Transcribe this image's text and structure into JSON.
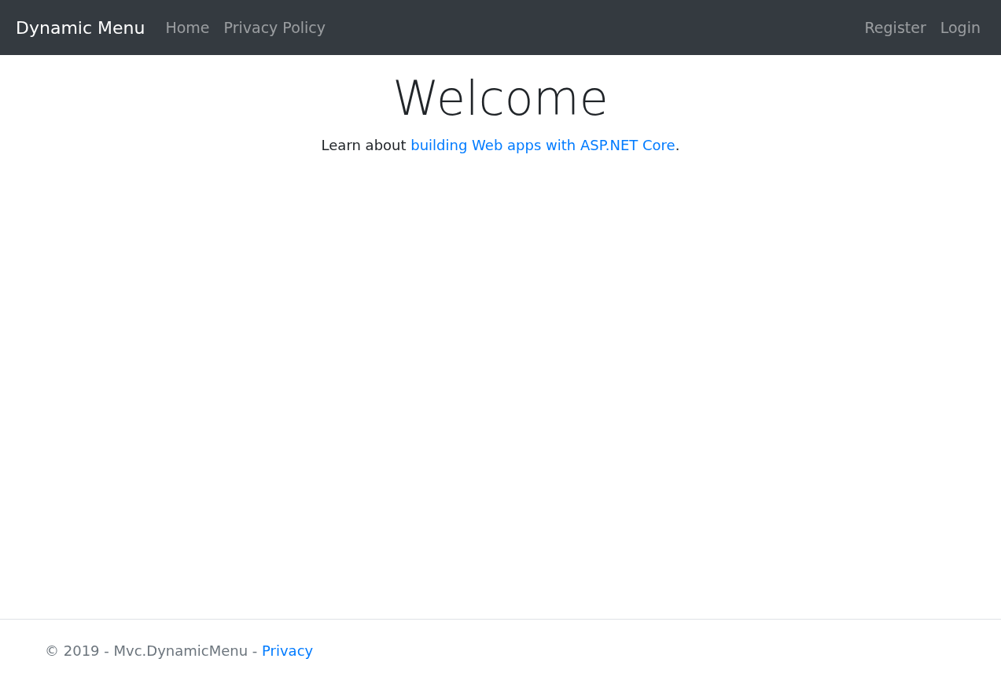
{
  "navbar": {
    "brand": "Dynamic Menu",
    "links": [
      "Home",
      "Privacy Policy"
    ],
    "account_links": [
      "Register",
      "Login"
    ]
  },
  "main": {
    "heading": "Welcome",
    "intro": {
      "before": "Learn about ",
      "link": "building Web apps with ASP.NET Core",
      "after": "."
    }
  },
  "footer": {
    "text": "© 2019 - Mvc.DynamicMenu - ",
    "link": "Privacy"
  }
}
